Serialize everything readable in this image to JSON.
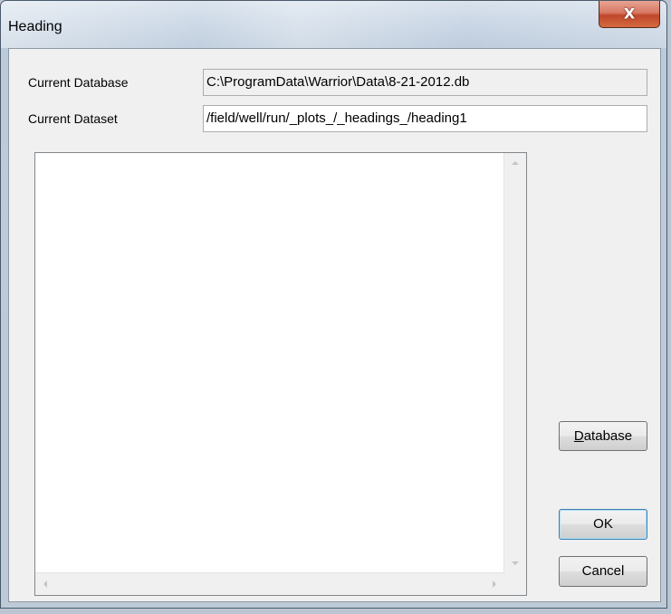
{
  "window": {
    "title": "Heading",
    "close_glyph": "X"
  },
  "form": {
    "current_database_label": "Current Database",
    "current_database_value": "C:\\ProgramData\\Warrior\\Data\\8-21-2012.db",
    "current_dataset_label": "Current Dataset",
    "current_dataset_value": "/field/well/run/_plots_/_headings_/heading1"
  },
  "buttons": {
    "database_accel": "D",
    "database_rest": "atabase",
    "ok": "OK",
    "cancel": "Cancel"
  },
  "list": {
    "items": []
  },
  "icons": {
    "close": "close-icon",
    "scroll_up": "scroll-up-arrow-icon",
    "scroll_down": "scroll-down-arrow-icon",
    "scroll_left": "scroll-left-arrow-icon",
    "scroll_right": "scroll-right-arrow-icon"
  },
  "colors": {
    "close_button": "#c7462b",
    "dialog_background": "#f0f0f0"
  }
}
